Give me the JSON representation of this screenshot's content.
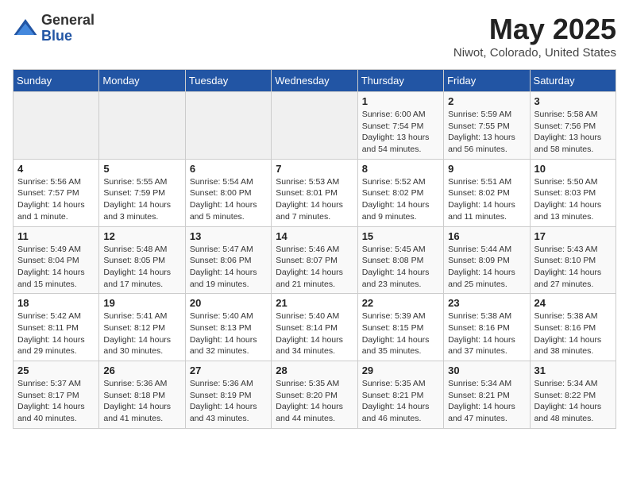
{
  "header": {
    "logo_general": "General",
    "logo_blue": "Blue",
    "title": "May 2025",
    "subtitle": "Niwot, Colorado, United States"
  },
  "weekdays": [
    "Sunday",
    "Monday",
    "Tuesday",
    "Wednesday",
    "Thursday",
    "Friday",
    "Saturday"
  ],
  "weeks": [
    [
      {
        "day": "",
        "info": ""
      },
      {
        "day": "",
        "info": ""
      },
      {
        "day": "",
        "info": ""
      },
      {
        "day": "",
        "info": ""
      },
      {
        "day": "1",
        "info": "Sunrise: 6:00 AM\nSunset: 7:54 PM\nDaylight: 13 hours\nand 54 minutes."
      },
      {
        "day": "2",
        "info": "Sunrise: 5:59 AM\nSunset: 7:55 PM\nDaylight: 13 hours\nand 56 minutes."
      },
      {
        "day": "3",
        "info": "Sunrise: 5:58 AM\nSunset: 7:56 PM\nDaylight: 13 hours\nand 58 minutes."
      }
    ],
    [
      {
        "day": "4",
        "info": "Sunrise: 5:56 AM\nSunset: 7:57 PM\nDaylight: 14 hours\nand 1 minute."
      },
      {
        "day": "5",
        "info": "Sunrise: 5:55 AM\nSunset: 7:59 PM\nDaylight: 14 hours\nand 3 minutes."
      },
      {
        "day": "6",
        "info": "Sunrise: 5:54 AM\nSunset: 8:00 PM\nDaylight: 14 hours\nand 5 minutes."
      },
      {
        "day": "7",
        "info": "Sunrise: 5:53 AM\nSunset: 8:01 PM\nDaylight: 14 hours\nand 7 minutes."
      },
      {
        "day": "8",
        "info": "Sunrise: 5:52 AM\nSunset: 8:02 PM\nDaylight: 14 hours\nand 9 minutes."
      },
      {
        "day": "9",
        "info": "Sunrise: 5:51 AM\nSunset: 8:02 PM\nDaylight: 14 hours\nand 11 minutes."
      },
      {
        "day": "10",
        "info": "Sunrise: 5:50 AM\nSunset: 8:03 PM\nDaylight: 14 hours\nand 13 minutes."
      }
    ],
    [
      {
        "day": "11",
        "info": "Sunrise: 5:49 AM\nSunset: 8:04 PM\nDaylight: 14 hours\nand 15 minutes."
      },
      {
        "day": "12",
        "info": "Sunrise: 5:48 AM\nSunset: 8:05 PM\nDaylight: 14 hours\nand 17 minutes."
      },
      {
        "day": "13",
        "info": "Sunrise: 5:47 AM\nSunset: 8:06 PM\nDaylight: 14 hours\nand 19 minutes."
      },
      {
        "day": "14",
        "info": "Sunrise: 5:46 AM\nSunset: 8:07 PM\nDaylight: 14 hours\nand 21 minutes."
      },
      {
        "day": "15",
        "info": "Sunrise: 5:45 AM\nSunset: 8:08 PM\nDaylight: 14 hours\nand 23 minutes."
      },
      {
        "day": "16",
        "info": "Sunrise: 5:44 AM\nSunset: 8:09 PM\nDaylight: 14 hours\nand 25 minutes."
      },
      {
        "day": "17",
        "info": "Sunrise: 5:43 AM\nSunset: 8:10 PM\nDaylight: 14 hours\nand 27 minutes."
      }
    ],
    [
      {
        "day": "18",
        "info": "Sunrise: 5:42 AM\nSunset: 8:11 PM\nDaylight: 14 hours\nand 29 minutes."
      },
      {
        "day": "19",
        "info": "Sunrise: 5:41 AM\nSunset: 8:12 PM\nDaylight: 14 hours\nand 30 minutes."
      },
      {
        "day": "20",
        "info": "Sunrise: 5:40 AM\nSunset: 8:13 PM\nDaylight: 14 hours\nand 32 minutes."
      },
      {
        "day": "21",
        "info": "Sunrise: 5:40 AM\nSunset: 8:14 PM\nDaylight: 14 hours\nand 34 minutes."
      },
      {
        "day": "22",
        "info": "Sunrise: 5:39 AM\nSunset: 8:15 PM\nDaylight: 14 hours\nand 35 minutes."
      },
      {
        "day": "23",
        "info": "Sunrise: 5:38 AM\nSunset: 8:16 PM\nDaylight: 14 hours\nand 37 minutes."
      },
      {
        "day": "24",
        "info": "Sunrise: 5:38 AM\nSunset: 8:16 PM\nDaylight: 14 hours\nand 38 minutes."
      }
    ],
    [
      {
        "day": "25",
        "info": "Sunrise: 5:37 AM\nSunset: 8:17 PM\nDaylight: 14 hours\nand 40 minutes."
      },
      {
        "day": "26",
        "info": "Sunrise: 5:36 AM\nSunset: 8:18 PM\nDaylight: 14 hours\nand 41 minutes."
      },
      {
        "day": "27",
        "info": "Sunrise: 5:36 AM\nSunset: 8:19 PM\nDaylight: 14 hours\nand 43 minutes."
      },
      {
        "day": "28",
        "info": "Sunrise: 5:35 AM\nSunset: 8:20 PM\nDaylight: 14 hours\nand 44 minutes."
      },
      {
        "day": "29",
        "info": "Sunrise: 5:35 AM\nSunset: 8:21 PM\nDaylight: 14 hours\nand 46 minutes."
      },
      {
        "day": "30",
        "info": "Sunrise: 5:34 AM\nSunset: 8:21 PM\nDaylight: 14 hours\nand 47 minutes."
      },
      {
        "day": "31",
        "info": "Sunrise: 5:34 AM\nSunset: 8:22 PM\nDaylight: 14 hours\nand 48 minutes."
      }
    ]
  ]
}
